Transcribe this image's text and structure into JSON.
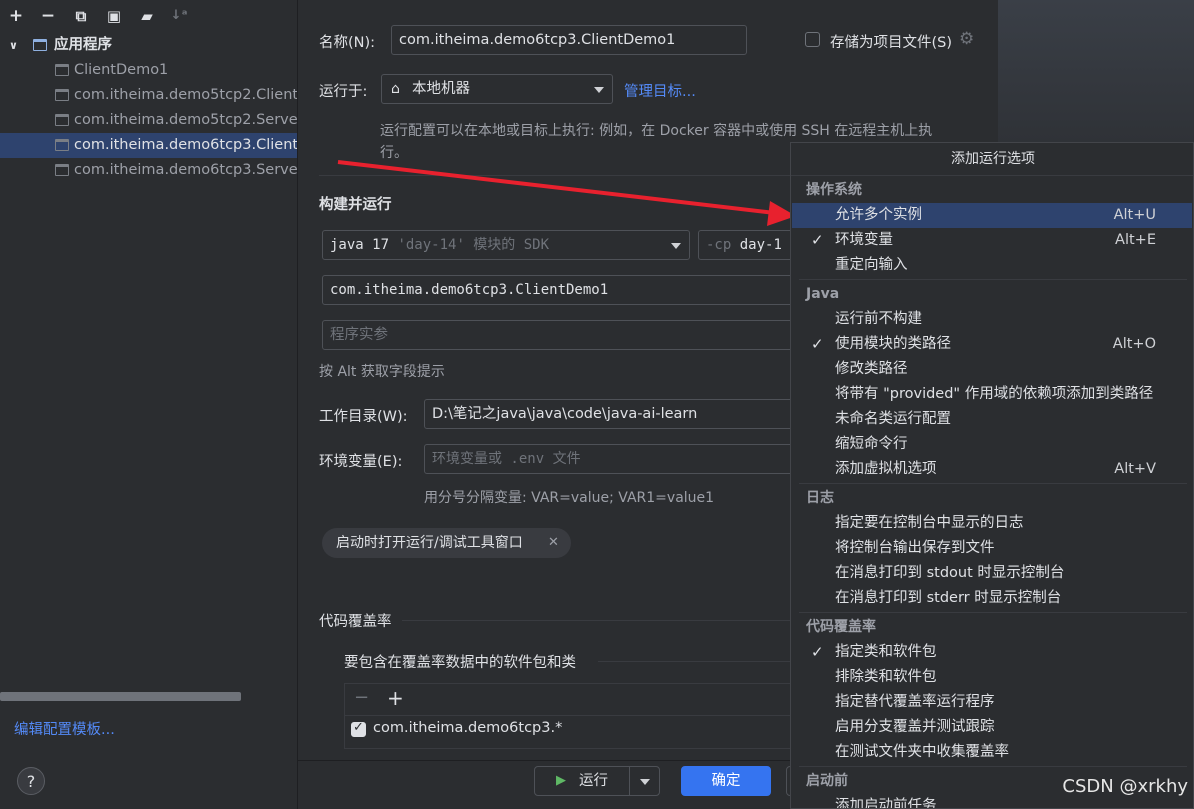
{
  "left": {
    "root_label": "应用程序",
    "items": [
      {
        "label": "ClientDemo1",
        "selected": false
      },
      {
        "label": "com.itheima.demo5tcp2.ClientDemo1",
        "selected": false
      },
      {
        "label": "com.itheima.demo5tcp2.ServerDemo1",
        "selected": false
      },
      {
        "label": "com.itheima.demo6tcp3.ClientDemo1",
        "selected": true
      },
      {
        "label": "com.itheima.demo6tcp3.ServerDemo1",
        "selected": false
      }
    ],
    "edit_templates": "编辑配置模板...",
    "help": "?"
  },
  "form": {
    "name_label": "名称(N):",
    "name_value": "com.itheima.demo6tcp3.ClientDemo1",
    "store_label": "存储为项目文件(S)",
    "run_on_label": "运行于:",
    "run_on_value": "本地机器",
    "manage_targets": "管理目标...",
    "run_on_hint_1": "运行配置可以在本地或目标上执行: 例如，在 Docker 容器中或使用 SSH 在远程主机上执",
    "run_on_hint_2": "行。",
    "build_run_title": "构建并运行",
    "sdk_prefix": "java 17",
    "sdk_detail": "'day-14' 模块的 SDK",
    "cp_prefix": "-cp",
    "cp_value": "day-1",
    "main_class": "com.itheima.demo6tcp3.ClientDemo1",
    "program_args_placeholder": "程序实参",
    "alt_hint": "按 Alt 获取字段提示",
    "workdir_label": "工作目录(W):",
    "workdir_value": "D:\\笔记之java\\java\\code\\java-ai-learn",
    "env_label": "环境变量(E):",
    "env_placeholder": "环境变量或 .env 文件",
    "env_hint": "用分号分隔变量: VAR=value; VAR1=value1",
    "chip_label": "启动时打开运行/调试工具窗口",
    "coverage_title": "代码覆盖率",
    "coverage_sub": "要包含在覆盖率数据中的软件包和类",
    "coverage_item": "com.itheima.demo6tcp3.*",
    "run_button": "运行",
    "ok_button": "确定"
  },
  "popup": {
    "title": "添加运行选项",
    "sections": [
      {
        "header": "操作系统",
        "items": [
          {
            "label": "允许多个实例",
            "shortcut": "Alt+U",
            "checked": false,
            "selected": true
          },
          {
            "label": "环境变量",
            "shortcut": "Alt+E",
            "checked": true,
            "selected": false
          },
          {
            "label": "重定向输入",
            "shortcut": "",
            "checked": false,
            "selected": false
          }
        ]
      },
      {
        "header": "Java",
        "items": [
          {
            "label": "运行前不构建",
            "shortcut": "",
            "checked": false,
            "selected": false
          },
          {
            "label": "使用模块的类路径",
            "shortcut": "Alt+O",
            "checked": true,
            "selected": false
          },
          {
            "label": "修改类路径",
            "shortcut": "",
            "checked": false,
            "selected": false
          },
          {
            "label": "将带有 \"provided\" 作用域的依赖项添加到类路径",
            "shortcut": "",
            "checked": false,
            "selected": false
          },
          {
            "label": "未命名类运行配置",
            "shortcut": "",
            "checked": false,
            "selected": false
          },
          {
            "label": "缩短命令行",
            "shortcut": "",
            "checked": false,
            "selected": false
          },
          {
            "label": "添加虚拟机选项",
            "shortcut": "Alt+V",
            "checked": false,
            "selected": false
          }
        ]
      },
      {
        "header": "日志",
        "items": [
          {
            "label": "指定要在控制台中显示的日志",
            "shortcut": "",
            "checked": false,
            "selected": false
          },
          {
            "label": "将控制台输出保存到文件",
            "shortcut": "",
            "checked": false,
            "selected": false
          },
          {
            "label": "在消息打印到 stdout 时显示控制台",
            "shortcut": "",
            "checked": false,
            "selected": false
          },
          {
            "label": "在消息打印到 stderr 时显示控制台",
            "shortcut": "",
            "checked": false,
            "selected": false
          }
        ]
      },
      {
        "header": "代码覆盖率",
        "items": [
          {
            "label": "指定类和软件包",
            "shortcut": "",
            "checked": true,
            "selected": false
          },
          {
            "label": "排除类和软件包",
            "shortcut": "",
            "checked": false,
            "selected": false
          },
          {
            "label": "指定替代覆盖率运行程序",
            "shortcut": "",
            "checked": false,
            "selected": false
          },
          {
            "label": "启用分支覆盖并测试跟踪",
            "shortcut": "",
            "checked": false,
            "selected": false
          },
          {
            "label": "在测试文件夹中收集覆盖率",
            "shortcut": "",
            "checked": false,
            "selected": false
          }
        ]
      },
      {
        "header": "启动前",
        "items": [
          {
            "label": "添加启动前任务",
            "shortcut": "",
            "checked": false,
            "selected": false
          }
        ]
      }
    ]
  },
  "watermark": "CSDN @xrkhy"
}
